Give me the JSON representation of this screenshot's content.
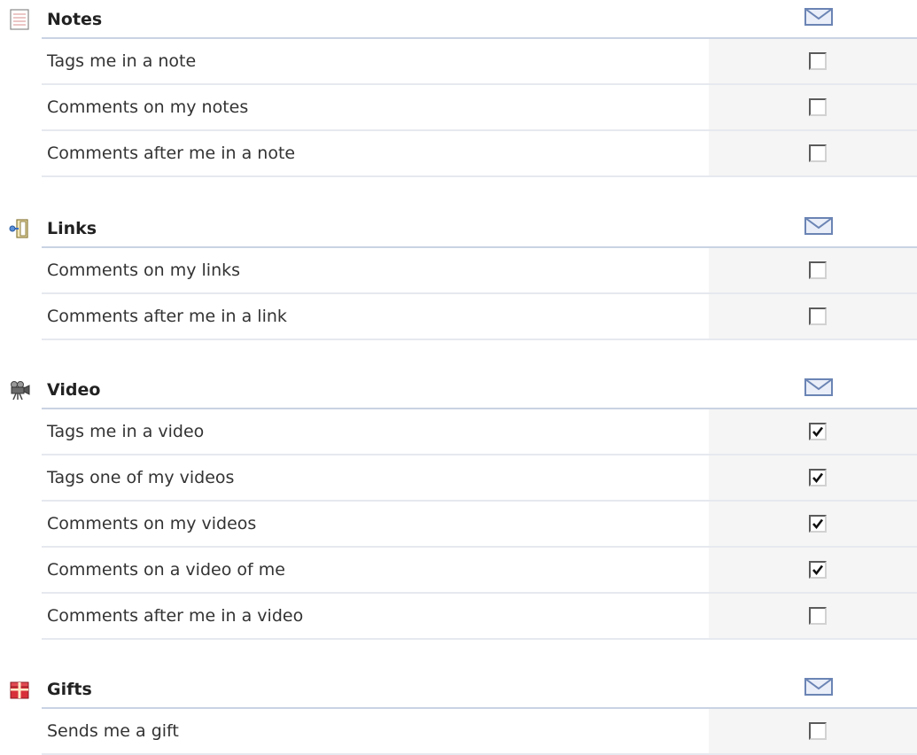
{
  "colors": {
    "header_rule": "#c9d3e3",
    "row_rule": "#e6e9ef",
    "checkbox_column_bg": "#f5f5f5",
    "mail_icon": "#6b84b4"
  },
  "sections": [
    {
      "title": "Notes",
      "icon": "notes-icon",
      "rows": [
        {
          "label": "Tags me in a note",
          "checked": false
        },
        {
          "label": "Comments on my notes",
          "checked": false
        },
        {
          "label": "Comments after me in a note",
          "checked": false
        }
      ]
    },
    {
      "title": "Links",
      "icon": "links-icon",
      "rows": [
        {
          "label": "Comments on my links",
          "checked": false
        },
        {
          "label": "Comments after me in a link",
          "checked": false
        }
      ]
    },
    {
      "title": "Video",
      "icon": "video-camera-icon",
      "rows": [
        {
          "label": "Tags me in a video",
          "checked": true
        },
        {
          "label": "Tags one of my videos",
          "checked": true
        },
        {
          "label": "Comments on my videos",
          "checked": true
        },
        {
          "label": "Comments on a video of me",
          "checked": true
        },
        {
          "label": "Comments after me in a video",
          "checked": false
        }
      ]
    },
    {
      "title": "Gifts",
      "icon": "gift-icon",
      "rows": [
        {
          "label": "Sends me a gift",
          "checked": false
        }
      ]
    }
  ]
}
